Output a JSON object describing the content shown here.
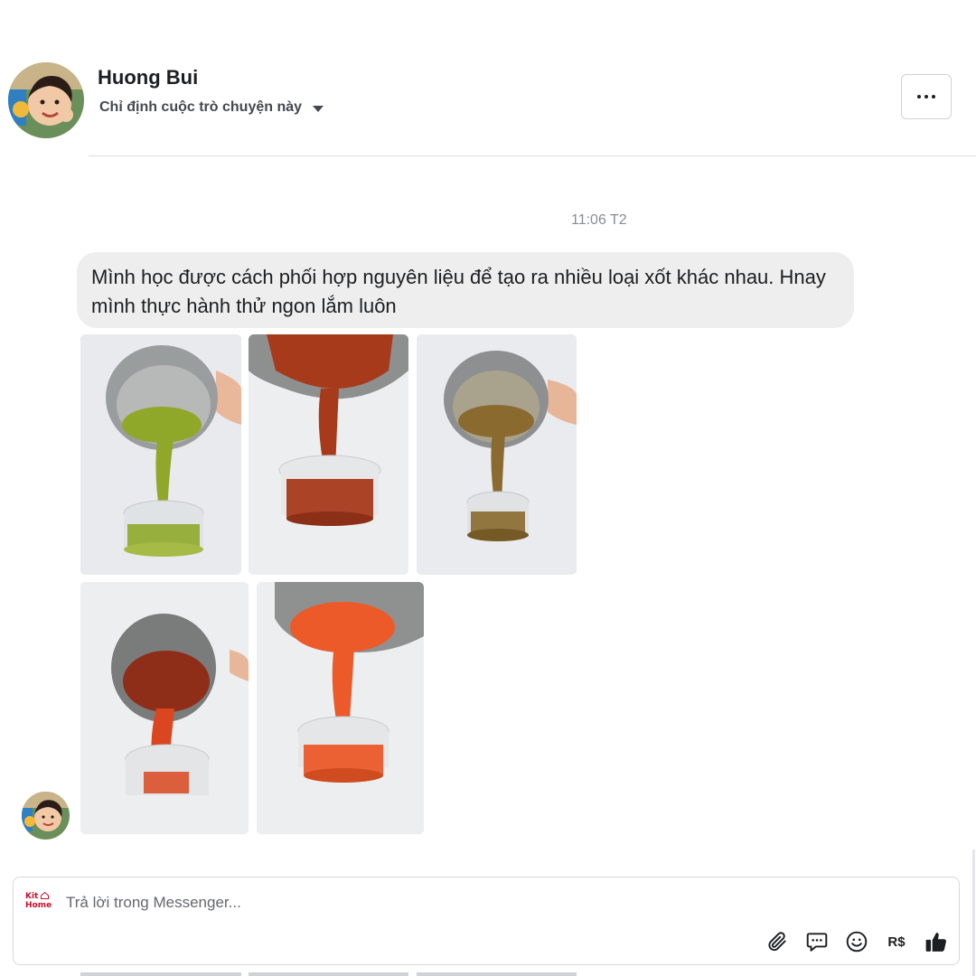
{
  "header": {
    "name": "Huong Bui",
    "assign_label": "Chỉ định cuộc trò chuyện này"
  },
  "thread": {
    "timestamp": "11:06 T2",
    "message_text": "Mình học được cách phối hợp nguyên liệu để tạo ra nhiều loại xốt khác nhau. Hnay mình thực hành thử ngon lắm luôn",
    "photos": [
      {
        "name": "photo-green-sauce",
        "sauce_color": "#8fa82a"
      },
      {
        "name": "photo-red-sauce",
        "sauce_color": "#a83a1c"
      },
      {
        "name": "photo-brown-sauce",
        "sauce_color": "#8a6a2e"
      },
      {
        "name": "photo-chili-sauce",
        "sauce_color": "#d9461f"
      },
      {
        "name": "photo-orange-sauce",
        "sauce_color": "#ec5a2a"
      }
    ]
  },
  "composer": {
    "placeholder": "Trả lời trong Messenger...",
    "brand_line1": "Kit",
    "brand_line2": "Home",
    "currency_label": "R$",
    "icons": [
      "paperclip-icon",
      "quick-reply-icon",
      "emoji-icon",
      "currency-icon",
      "thumbs-up-icon"
    ]
  },
  "colors": {
    "bubble_bg": "#eeeeee",
    "brand_red": "#c8102e",
    "muted_text": "#8a8d91"
  }
}
